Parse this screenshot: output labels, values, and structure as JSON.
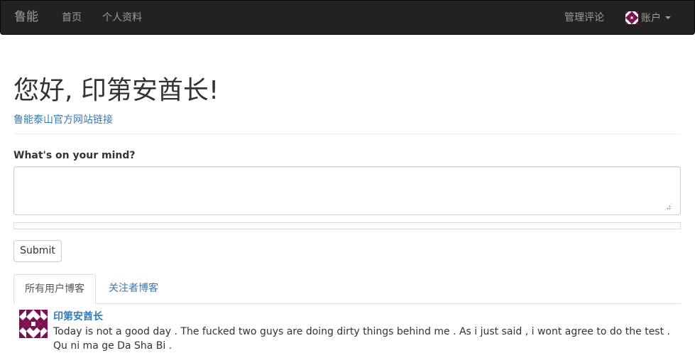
{
  "navbar": {
    "brand": "鲁能",
    "home_label": "首页",
    "profile_label": "个人资料",
    "moderate_label": "管理评论",
    "account_label": "账户"
  },
  "header": {
    "greeting": "您好, 印第安酋长!",
    "official_link": "鲁能泰山官方网站链接"
  },
  "post_form": {
    "label": "What's on your mind?",
    "textarea_value": "",
    "submit_label": "Submit"
  },
  "tabs": [
    {
      "label": "所有用户博客",
      "active": true
    },
    {
      "label": "关注者博客",
      "active": false
    }
  ],
  "posts": [
    {
      "author": "印第安酋长",
      "body": "Today is not a good day . The fucked two guys are doing dirty things behind me . As i just said , i wont agree to do the test . Qu ni ma ge Da Sha Bi ."
    }
  ],
  "colors": {
    "navbar_bg": "#222222",
    "navbar_text": "#9d9d9d",
    "link": "#337ab7",
    "identicon": "#7b1150"
  }
}
